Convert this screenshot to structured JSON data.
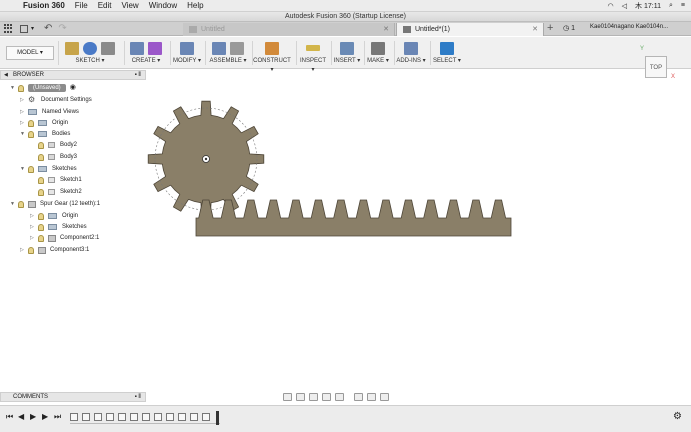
{
  "menubar": {
    "app_name": "Fusion 360",
    "menus": [
      "File",
      "Edit",
      "View",
      "Window",
      "Help"
    ],
    "status_time": "木 17:11"
  },
  "window": {
    "title": "Autodesk Fusion 360 (Startup License)"
  },
  "tabs": [
    {
      "label": "Untitled",
      "active": false
    },
    {
      "label": "Untitled*(1)",
      "active": true
    }
  ],
  "tab_extras": {
    "job_count": "1",
    "user": "Kae0104nagano Kae0104n..."
  },
  "toolbar": {
    "workspace": "MODEL ▾",
    "groups": [
      {
        "label": "SKETCH ▾",
        "colors": [
          "#c7a44a",
          "#4a7ac7",
          "#8a8a8a"
        ]
      },
      {
        "label": "CREATE ▾",
        "colors": [
          "#6a86b5",
          "#9b57c9"
        ]
      },
      {
        "label": "MODIFY ▾",
        "colors": [
          "#6a86b5",
          "#8a8a8a"
        ]
      },
      {
        "label": "ASSEMBLE ▾",
        "colors": [
          "#6a86b5",
          "#999999"
        ]
      },
      {
        "label": "CONSTRUCT ▾",
        "colors": [
          "#d28a3a"
        ]
      },
      {
        "label": "INSPECT ▾",
        "colors": [
          "#d2b54a"
        ]
      },
      {
        "label": "INSERT ▾",
        "colors": [
          "#6a8ab5"
        ]
      },
      {
        "label": "MAKE ▾",
        "colors": [
          "#777777"
        ]
      },
      {
        "label": "ADD-INS ▾",
        "colors": [
          "#6a86b5"
        ]
      },
      {
        "label": "SELECT ▾",
        "colors": [
          "#2e7cc7"
        ]
      }
    ]
  },
  "browser": {
    "title": "BROWSER",
    "items": [
      {
        "label": "(Unsaved)",
        "icon": "document-icon"
      },
      {
        "label": "Document Settings",
        "icon": "gear-icon"
      },
      {
        "label": "Named Views",
        "icon": "folder-icon"
      },
      {
        "label": "Origin",
        "icon": "folder-icon"
      },
      {
        "label": "Bodies",
        "icon": "folder-icon"
      },
      {
        "label": "Body2",
        "icon": "body-icon"
      },
      {
        "label": "Body3",
        "icon": "body-icon"
      },
      {
        "label": "Sketches",
        "icon": "folder-icon"
      },
      {
        "label": "Sketch1",
        "icon": "sketch-icon"
      },
      {
        "label": "Sketch2",
        "icon": "sketch-icon"
      },
      {
        "label": "Spur Gear (12 teeth):1",
        "icon": "component-icon"
      },
      {
        "label": "Origin",
        "icon": "folder-icon"
      },
      {
        "label": "Sketches",
        "icon": "folder-icon"
      },
      {
        "label": "Component2:1",
        "icon": "component-icon"
      },
      {
        "label": "Component3:1",
        "icon": "component-icon"
      }
    ]
  },
  "comments": {
    "title": "COMMENTS"
  },
  "viewcube": {
    "face": "TOP",
    "axis_x": "X",
    "axis_y": "Y"
  },
  "model": {
    "gear_teeth": 12,
    "rack_teeth": 14,
    "colors": {
      "part": "#8a7f68",
      "part_edge": "#4d4537"
    }
  }
}
